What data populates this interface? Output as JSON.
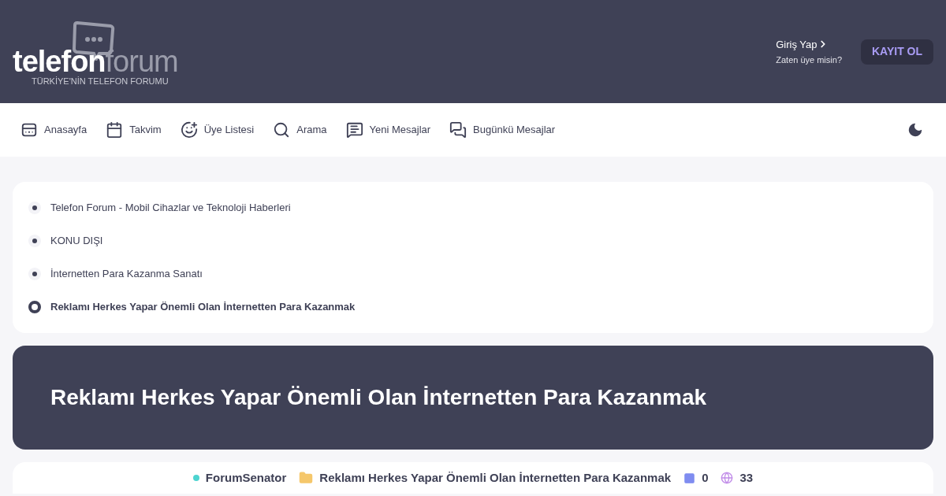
{
  "header": {
    "logo": {
      "word_1": "telefon",
      "word_2": "forum",
      "tagline": "TÜRKİYE'NİN TELEFON FORUMU"
    },
    "login": {
      "label": "Giriş Yap",
      "caption": "Zaten üye misin?"
    },
    "register_button": "KAYIT OL"
  },
  "nav": [
    {
      "label": "Anasayfa"
    },
    {
      "label": "Takvim"
    },
    {
      "label": "Üye Listesi"
    },
    {
      "label": "Arama"
    },
    {
      "label": "Yeni Mesajlar"
    },
    {
      "label": "Bugünkü Mesajlar"
    }
  ],
  "breadcrumbs": [
    {
      "label": "Telefon Forum - Mobil Cihazlar ve Teknoloji Haberleri",
      "selected": false
    },
    {
      "label": "KONU DIŞI",
      "selected": false
    },
    {
      "label": "İnternetten Para Kazanma Sanatı",
      "selected": false
    },
    {
      "label": "Reklamı Herkes Yapar Önemli Olan İnternetten Para Kazanmak",
      "selected": true
    }
  ],
  "thread_title": "Reklamı Herkes Yapar Önemli Olan İnternetten Para Kazanmak",
  "thread_meta": {
    "author": "ForumSenator",
    "title": "Reklamı Herkes Yapar Önemli Olan İnternetten Para Kazanmak",
    "replies": "0",
    "views": "33"
  }
}
